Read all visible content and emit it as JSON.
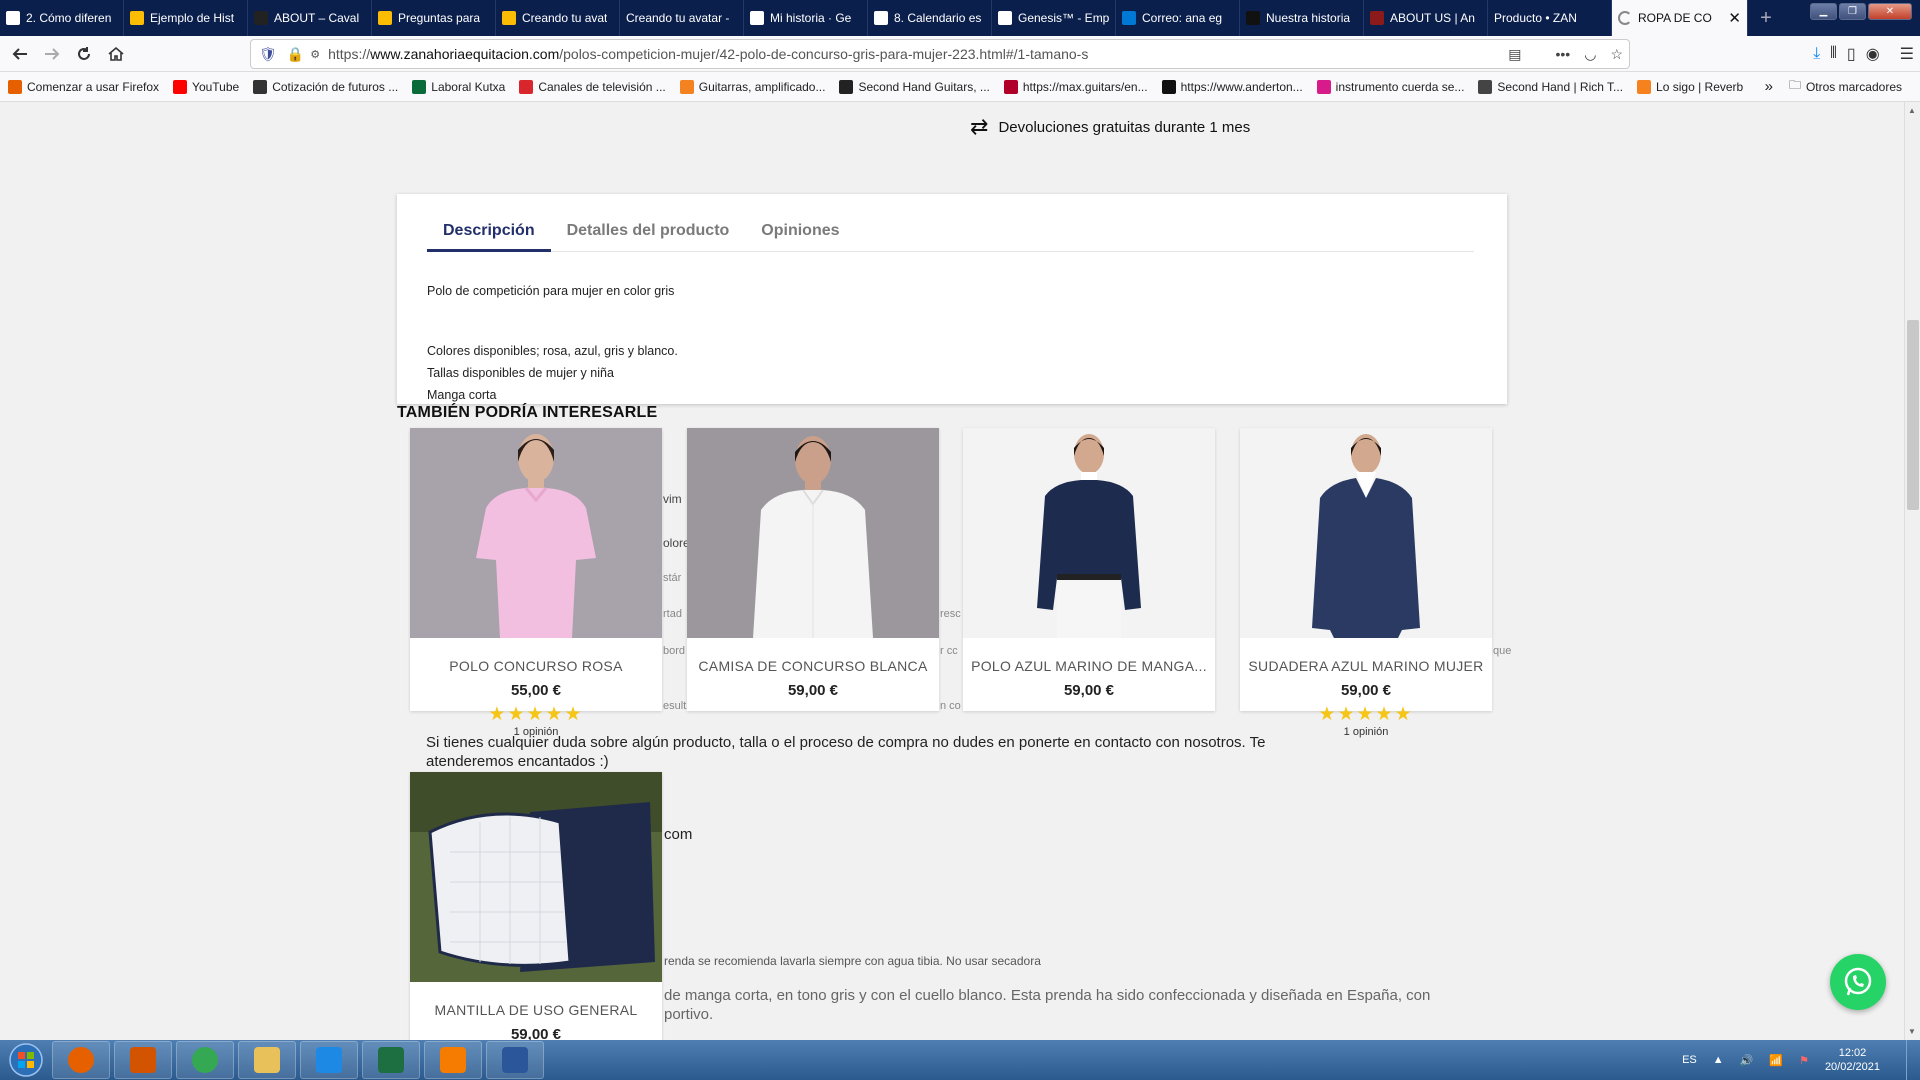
{
  "browser": {
    "tabs": [
      {
        "label": "2. Cómo diferen",
        "icon": "doc-icon",
        "color": "#ffffff"
      },
      {
        "label": "Ejemplo de Hist",
        "icon": "google-drive-icon",
        "color": "#fbbc04"
      },
      {
        "label": "ABOUT – Caval",
        "icon": "circle-logo-icon",
        "color": "#222222"
      },
      {
        "label": "Preguntas para",
        "icon": "google-drive-icon",
        "color": "#fbbc04"
      },
      {
        "label": "Creando tu avat",
        "icon": "google-drive-icon",
        "color": "#fbbc04"
      },
      {
        "label": "Creando tu avatar -",
        "icon": "none",
        "color": ""
      },
      {
        "label": "Mi historia · Ge",
        "icon": "sk-icon",
        "color": "#ffffff"
      },
      {
        "label": "8. Calendario es",
        "icon": "doc-icon",
        "color": "#ffffff"
      },
      {
        "label": "Genesis™ - Emp",
        "icon": "sk-icon",
        "color": "#ffffff"
      },
      {
        "label": "Correo: ana eg",
        "icon": "outlook-icon",
        "color": "#0078d4"
      },
      {
        "label": "Nuestra historia",
        "icon": "circle-logo-icon",
        "color": "#111111"
      },
      {
        "label": "ABOUT US | An",
        "icon": "brand-icon",
        "color": "#8b1a1a"
      },
      {
        "label": "Producto • ZAN",
        "icon": "none",
        "color": ""
      },
      {
        "label": "ROPA DE CO",
        "icon": "loading-icon",
        "color": "#888888"
      }
    ],
    "active_tab_index": 13,
    "new_tab_label": "+",
    "window_controls": {
      "minimize": "▁",
      "maximize": "❐",
      "close": "✕"
    },
    "url": {
      "scheme": "https://",
      "host": "www.zanahoriaequitacion.com",
      "path": "/polos-competicion-mujer/42-polo-de-concurso-gris-para-mujer-223.html#/1-tamano-s"
    },
    "bookmarks": [
      {
        "label": "Comenzar a usar Firefox",
        "icon": "firefox-icon",
        "color": "#e66000"
      },
      {
        "label": "YouTube",
        "icon": "youtube-icon",
        "color": "#ff0000"
      },
      {
        "label": "Cotización de futuros ...",
        "icon": "inv-icon",
        "color": "#333333"
      },
      {
        "label": "Laboral Kutxa",
        "icon": "bank-icon",
        "color": "#0a6b3a"
      },
      {
        "label": "Canales de televisión ...",
        "icon": "tv-icon",
        "color": "#d8262c"
      },
      {
        "label": "Guitarras, amplificado...",
        "icon": "shop-icon",
        "color": "#f58220"
      },
      {
        "label": "Second Hand Guitars, ...",
        "icon": "gg-icon",
        "color": "#222222"
      },
      {
        "label": "https://max.guitars/en...",
        "icon": "m-icon",
        "color": "#b0002a"
      },
      {
        "label": "https://www.anderton...",
        "icon": "a-icon",
        "color": "#111111"
      },
      {
        "label": "instrumento cuerda se...",
        "icon": "swoosh-icon",
        "color": "#d81b8a"
      },
      {
        "label": "Second Hand | Rich T...",
        "icon": "guitar-icon",
        "color": "#444444"
      },
      {
        "label": "Lo sigo | Reverb",
        "icon": "reverb-icon",
        "color": "#f5821f"
      }
    ],
    "bookmarks_more": "»",
    "other_bookmarks": "Otros marcadores"
  },
  "page": {
    "returns_text": "Devoluciones gratuitas durante 1 mes",
    "tabs": [
      "Descripción",
      "Detalles del producto",
      "Opiniones"
    ],
    "active_tab": 0,
    "description_lines": [
      "Polo de competición para mujer en color gris",
      "",
      "Colores disponibles; rosa, azul, gris y blanco.",
      "Tallas disponibles de mujer y niña",
      "Manga corta"
    ],
    "related_title": "TAMBIÉN PODRÍA INTERESARLE",
    "bleed_text": {
      "contact": "Si tienes cualquier duda sobre algún producto, talla o el proceso de compra no dudes en ponerte en contacto con nosotros. Te",
      "contact2": "atenderemos encantados :)",
      "com": "com",
      "care": "renda se recomienda lavarla siempre con agua tibia. No usar secadora",
      "long1": "de manga corta, en tono gris y con el cuello blanco. Esta prenda ha sido confeccionada y diseñada en España, con",
      "long2": "portivo.",
      "frag_vim": "vim",
      "frag_olore": "olore",
      "frag_star": "stár",
      "frag_rtad": "rtad",
      "frag_resc": "resc",
      "frag_bord": "bord",
      "frag_rc": "r cc",
      "frag_que": "que",
      "frag_esult": "esult",
      "frag_nco": "n co"
    },
    "products": [
      {
        "name": "POLO CONCURSO ROSA",
        "price": "55,00 €",
        "stars": "★★★★★",
        "reviews": "1 opinión",
        "shirt_color": "#f2bfe0",
        "bg": "#a8a2aa"
      },
      {
        "name": "CAMISA DE CONCURSO BLANCA",
        "price": "59,00 €",
        "stars": "",
        "reviews": "",
        "shirt_color": "#f4f4f4",
        "bg": "#9c979c"
      },
      {
        "name": "POLO AZUL MARINO DE MANGA...",
        "price": "59,00 €",
        "stars": "",
        "reviews": "",
        "shirt_color": "#1d2b4f",
        "bg": "#f3f3f3"
      },
      {
        "name": "SUDADERA AZUL MARINO MUJER",
        "price": "59,00 €",
        "stars": "★★★★★",
        "reviews": "1 opinión",
        "shirt_color": "#2a3a62",
        "bg": "#f3f3f3"
      },
      {
        "name": "MANTILLA DE USO GENERAL",
        "price": "59,00 €",
        "stars": "",
        "reviews": "",
        "shirt_color": "#eef0f4",
        "bg": "#5b6b3a"
      }
    ]
  },
  "taskbar": {
    "apps": [
      "firefox-icon",
      "media-player-icon",
      "chrome-icon",
      "file-explorer-icon",
      "internet-explorer-icon",
      "excel-icon",
      "vlc-like-icon",
      "word-icon"
    ],
    "language": "ES",
    "time": "12:02",
    "date": "20/02/2021"
  }
}
